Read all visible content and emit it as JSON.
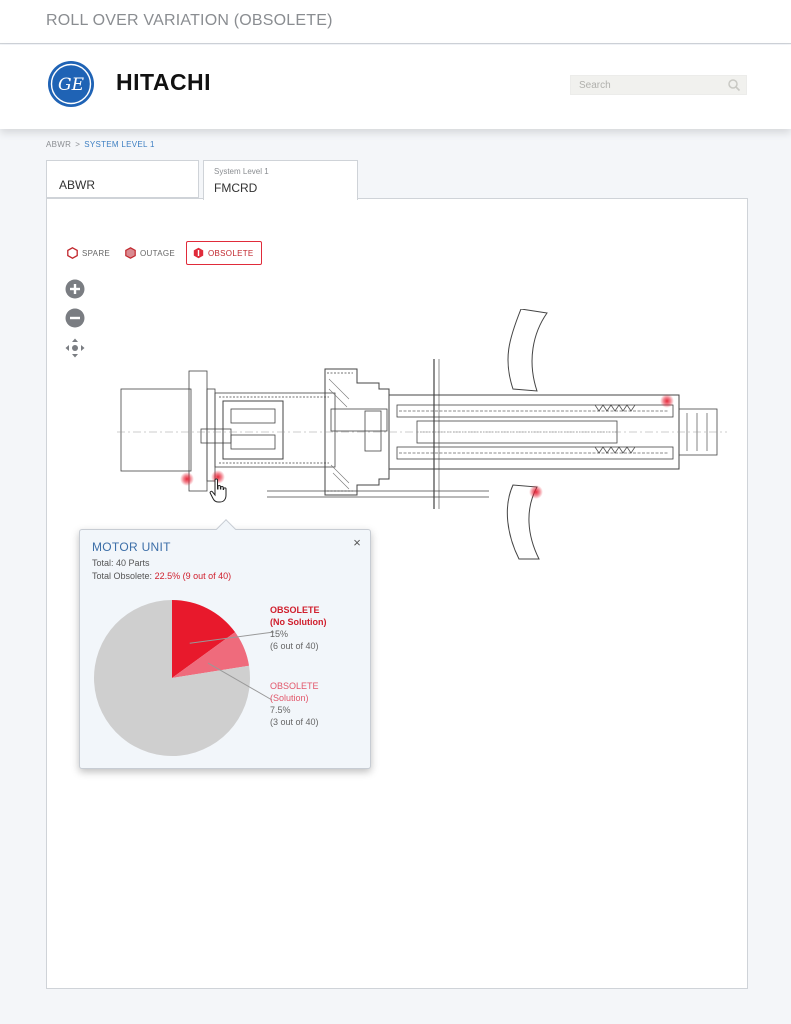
{
  "window": {
    "title": "ROLL OVER VARIATION (OBSOLETE)"
  },
  "header": {
    "logo_text": "HITACHI",
    "ge_logo_text": "GE",
    "search_placeholder": "Search"
  },
  "breadcrumb": {
    "root": "ABWR",
    "separator": ">",
    "current": "SYSTEM LEVEL 1"
  },
  "tabs": [
    {
      "label": "ABWR"
    },
    {
      "sublabel": "System Level 1",
      "label": "FMCRD"
    }
  ],
  "filters": [
    {
      "label": "SPARE",
      "icon": "hexagon-outline-icon",
      "active": false
    },
    {
      "label": "OUTAGE",
      "icon": "hexagon-filled-icon",
      "active": false
    },
    {
      "label": "OBSOLETE",
      "icon": "hexagon-alert-icon",
      "active": true
    }
  ],
  "zoom_controls": [
    "zoom-in-icon",
    "zoom-out-icon",
    "pan-icon"
  ],
  "popup": {
    "title": "MOTOR UNIT",
    "total_parts": "Total: 40 Parts",
    "total_obsolete_label": "Total Obsolete:",
    "total_obsolete_value": "22.5% (9 out of 40)",
    "close_symbol": "×",
    "legend": [
      {
        "name_line1": "OBSOLETE",
        "name_line2": "(No Solution)",
        "pct": "15%",
        "count": "(6 out of 40)"
      },
      {
        "name_line1": "OBSOLETE",
        "name_line2": "(Solution)",
        "pct": "7.5%",
        "count": "(3 out of 40)"
      }
    ]
  },
  "chart_data": {
    "type": "pie",
    "slices": [
      {
        "label": "OBSOLETE (No Solution)",
        "value": 15,
        "color": "#e8192c"
      },
      {
        "label": "OBSOLETE (Solution)",
        "value": 7.5,
        "color": "#ef6b7c"
      },
      {
        "label": "",
        "value": 77.5,
        "color": "#cfcfcf"
      }
    ]
  },
  "colors": {
    "accent_red": "#e02b3a",
    "link_blue": "#3d7fc2",
    "ge_blue": "#1f63b5"
  }
}
